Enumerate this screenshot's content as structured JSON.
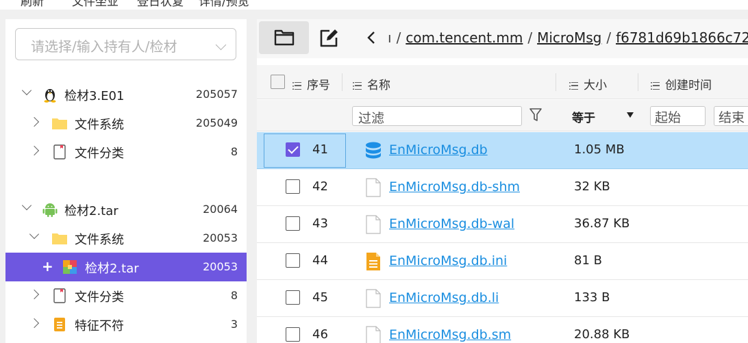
{
  "topbar": {
    "items": [
      "刷新",
      "文件坐业",
      "登日状复",
      "详情/预览"
    ]
  },
  "owner_select": {
    "placeholder": "请选择/输入持有人/检材"
  },
  "tree": [
    {
      "label": "检材3.E01",
      "count": "205057",
      "icon": "linux-icon",
      "indent": 0,
      "expander": "down"
    },
    {
      "label": "文件系统",
      "count": "205049",
      "icon": "folder-icon",
      "indent": 1,
      "expander": "right"
    },
    {
      "label": "文件分类",
      "count": "8",
      "icon": "file-category-icon",
      "indent": 1,
      "expander": "right"
    },
    {
      "label": "检材2.tar",
      "count": "20064",
      "icon": "android-icon",
      "indent": 0,
      "expander": "down"
    },
    {
      "label": "文件系统",
      "count": "20053",
      "icon": "folder-icon",
      "indent": 1,
      "expander": "down"
    },
    {
      "label": "检材2.tar",
      "count": "20053",
      "icon": "archive-icon",
      "indent": 2,
      "expander": "plus",
      "selected": true
    },
    {
      "label": "文件分类",
      "count": "8",
      "icon": "file-category-icon",
      "indent": 1,
      "expander": "right"
    },
    {
      "label": "特征不符",
      "count": "3",
      "icon": "mismatch-file-icon",
      "indent": 1,
      "expander": "right"
    }
  ],
  "path": {
    "crumbs": [
      "com.tencent.mm",
      "MicroMsg",
      "f6781d69b1866c72"
    ],
    "lead": "ı"
  },
  "table": {
    "headers": {
      "index": "序号",
      "name": "名称",
      "size": "大小",
      "created": "创建时间"
    },
    "filter": {
      "name": "过滤",
      "size_op": "等于",
      "date_start": "起始",
      "date_end": "结束"
    },
    "rows": [
      {
        "id": "41",
        "name": "EnMicroMsg.db",
        "size": "1.05 MB",
        "icon": "database-icon",
        "checked": true,
        "selected": true
      },
      {
        "id": "42",
        "name": "EnMicroMsg.db-shm",
        "size": "32 KB",
        "icon": "file-icon",
        "checked": false
      },
      {
        "id": "43",
        "name": "EnMicroMsg.db-wal",
        "size": "36.87 KB",
        "icon": "file-icon",
        "checked": false
      },
      {
        "id": "44",
        "name": "EnMicroMsg.db.ini",
        "size": "81 B",
        "icon": "text-file-icon",
        "checked": false
      },
      {
        "id": "45",
        "name": "EnMicroMsg.db.li",
        "size": "133 B",
        "icon": "file-icon",
        "checked": false
      },
      {
        "id": "46",
        "name": "EnMicroMsg.db.sm",
        "size": "20.88 KB",
        "icon": "file-icon",
        "checked": false
      }
    ]
  },
  "colors": {
    "accent": "#6e57e0",
    "link": "#1a8ee0",
    "row_selected": "#b9e0fb",
    "folder": "#fdd866",
    "db": "#1d8fe6",
    "orange": "#f4a51c"
  }
}
